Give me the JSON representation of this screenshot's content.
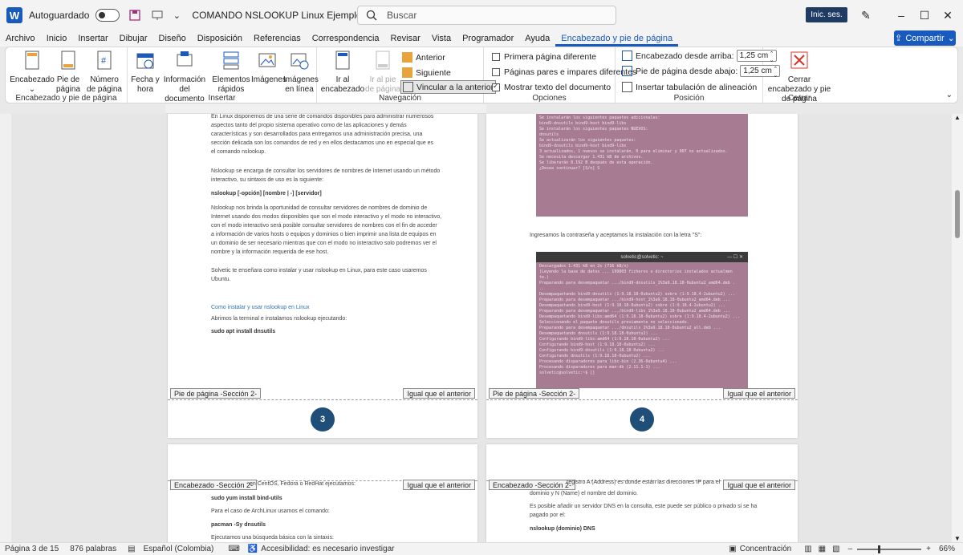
{
  "titlebar": {
    "autosave_label": "Autoguardado",
    "doc_title": "COMANDO NSLOOKUP Linux  Ejemplos cómo usar",
    "search_placeholder": "Buscar",
    "signin_label": "Inic. ses."
  },
  "menu": {
    "tabs": [
      "Archivo",
      "Inicio",
      "Insertar",
      "Dibujar",
      "Diseño",
      "Disposición",
      "Referencias",
      "Correspondencia",
      "Revisar",
      "Vista",
      "Programador",
      "Ayuda",
      "Encabezado y pie de página"
    ],
    "share_label": "Compartir"
  },
  "ribbon": {
    "groups": {
      "hf": "Encabezado y pie de página",
      "insert": "Insertar",
      "nav": "Navegación",
      "options": "Opciones",
      "position": "Posición",
      "close": "Cerrar"
    },
    "buttons": {
      "header": "Encabezado",
      "footer": "Pie de página",
      "page_number": "Número de página",
      "date_time": "Fecha y hora",
      "doc_info": "Información del documento",
      "quick_parts": "Elementos rápidos",
      "images": "Imágenes",
      "online_images": "Imágenes en línea",
      "go_header": "Ir al encabezado",
      "go_footer": "Ir al pie de página",
      "previous": "Anterior",
      "next": "Siguiente",
      "link_prev": "Vincular a la anterior",
      "close_hf": "Cerrar encabezado y pie de página"
    },
    "options": {
      "diff_first": "Primera página diferente",
      "diff_odd_even": "Páginas pares e impares diferentes",
      "show_doc_text": "Mostrar texto del documento"
    },
    "position": {
      "header_top_label": "Encabezado desde arriba:",
      "header_top_value": "1,25 cm",
      "footer_bottom_label": "Pie de página desde abajo:",
      "footer_bottom_value": "1,25 cm",
      "insert_tab": "Insertar tabulación de alineación"
    }
  },
  "page3": {
    "p1": [
      "En Linux disponemos de una serie de comandos disponibles para administrar numerosos",
      "aspectos tanto del propio sistema operativo como de las aplicaciones y demás",
      "características y son desarrollados para entregamos una administración precisa, una",
      "sección delicada son los comandos de red y en ellos destacamos uno en especial que es",
      "el comando nslookup."
    ],
    "p2": [
      "Nslookup se encarga de consultar los servidores de nombres de Internet usando un método",
      "interactivo, su sintaxis de uso es la siguiente:"
    ],
    "syntax": "nslookup [-opción] [nombre | -] [servidor]",
    "p3": [
      "Nslookup nos brinda la oportunidad de consultar servidores de nombres de dominio de",
      "Internet usando dos modos disponibles que son el modo interactivo y el modo no interactivo,",
      "con el modo interactivo será posible consultar servidores de nombres con el fin de acceder",
      "a  información de varios hosts o equipos y dominios o bien imprimir una lista de equipos en",
      "un dominio de ser necesario mientras que con el modo no interactivo solo podremos ver el",
      "nombre y la información requerida de ese host."
    ],
    "p4": [
      "Solvetic te enseñara como instalar y usar nslookup en Linux, para este caso usaremos",
      "Ubuntu."
    ],
    "heading": "Como instalar y usar nslookup en Linux",
    "p5": "Abrimos la terminal e instalamos nslookup ejecutando:",
    "cmd": "sudo apt install dnsutils",
    "footer_label": "Pie de página -Sección 2-",
    "same_label": "Igual que el anterior",
    "page_number": "3"
  },
  "page4": {
    "term1": [
      "Se instalarán los siguientes paquetes adicionales:",
      "  bind9-dnsutils bind9-host bind9-libs",
      "Se instalarán los siguientes paquetes NUEVOS:",
      "  dnsutils",
      "Se actualizarán los siguientes paquetes:",
      "  bind9-dnsutils bind9-host bind9-libs",
      "3 actualizados, 1 nuevos se instalarán, 0 para eliminar y 907 no actualizados.",
      "Se necesita descargar 1.431 kB de archivos.",
      "Se liberarán 8.192 B después de esta operación.",
      "¿Desea continuar? [S/n] S"
    ],
    "caption": "Ingresamos la contraseña y aceptamos la instalación con la letra \"S\":",
    "term_title": "solvetic@solvetic: ~",
    "term2": [
      "Descargados 1.431 kB en 2s (716 kB/s)",
      "(Leyendo la base de datos ... 199803 ficheros o directorios instalados actualmen",
      "te.)",
      "Preparando para desempaquetar .../bind9-dnsutils_1%3a9.18.18-0ubuntu2_amd64.deb .",
      "..",
      "Desempaquetando bind9-dnsutils (1:9.18.18-0ubuntu2) sobre (1:9.18.4-2ubuntu2) ...",
      "",
      "Preparando para desempaquetar .../bind9-host_1%3a9.18.18-0ubuntu2_amd64.deb ...",
      "Desempaquetando bind9-host (1:9.18.18-0ubuntu2) sobre (1:9.18.4-2ubuntu2) ...",
      "Preparando para desempaquetar .../bind9-libs_1%3a9.18.18-0ubuntu2_amd64.deb ...",
      "Desempaquetando bind9-libs:amd64 (1:9.18.18-0ubuntu2) sobre (1:9.18.4-2ubuntu2) ...",
      "",
      "Seleccionando el paquete dnsutils previamente no seleccionado.",
      "Preparando para desempaquetar .../dnsutils_1%3a9.18.18-0ubuntu2_all.deb ...",
      "Desempaquetando dnsutils (1:9.18.18-0ubuntu2) ...",
      "Configurando bind9-libs:amd64 (1:9.18.18-0ubuntu2) ...",
      "Configurando bind9-host (1:9.18.18-0ubuntu2) ...",
      "Configurando bind9-dnsutils (1:9.18.18-0ubuntu2) ...",
      "Configurando dnsutils (1:9.18.18-0ubuntu2) ...",
      "Procesando disparadores para libc-bin (2.36-0ubuntu4) ...",
      "Procesando disparadores para man-db (2.11.1-1) ...",
      "solvetic@solvetic:~$ []"
    ],
    "footer_label": "Pie de página -Sección 2-",
    "same_label": "Igual que el anterior",
    "page_number": "4"
  },
  "page5": {
    "header_label": "Encabezado -Sección 2-",
    "same_label": "Igual que el anterior",
    "partial": "en CentOS, Fedora o RedHat ejecutamos:",
    "cmd1": "sudo yum install bind-utils",
    "p1": "Para el caso de ArchLinux usamos el comando:",
    "cmd2": "pacman -Sy dnsutils",
    "p2": "Ejecutamos una búsqueda básica con la sintaxis:"
  },
  "page6": {
    "header_label": "Encabezado -Sección 2-",
    "same_label": "Igual que el anterior",
    "partial1": "registro A (Address) es donde están las direcciones IP para el",
    "partial2": "dominio y N (Name) el nombre del dominio.",
    "p1": [
      "Es posible añadir un servidor DNS en la consulta, este puede ser público o privado si se ha",
      "pagado por el:"
    ],
    "cmd": "nslookup (dominio) DNS"
  },
  "status": {
    "page": "Página 3 de 15",
    "words": "876 palabras",
    "lang": "Español (Colombia)",
    "access": "Accesibilidad: es necesario investigar",
    "focus": "Concentración",
    "zoom": "66%"
  }
}
